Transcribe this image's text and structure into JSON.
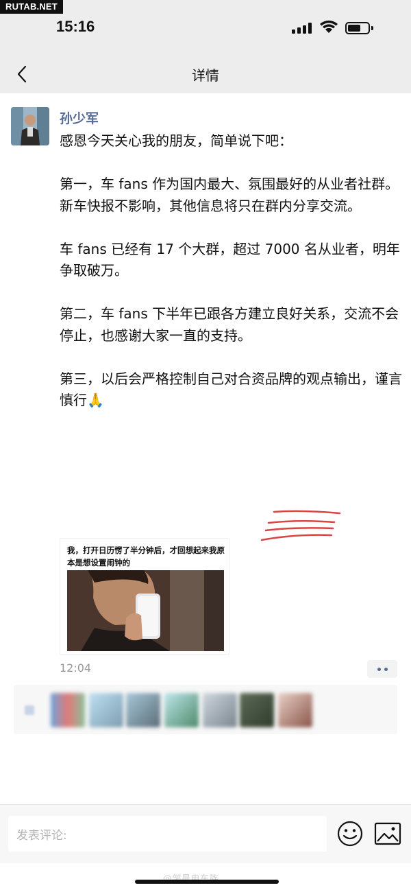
{
  "watermark_top": "RUTAB.NET",
  "status_bar": {
    "time": "15:16"
  },
  "nav": {
    "title": "详情",
    "back_icon": "chevron-left-icon"
  },
  "post": {
    "author": "孙少军",
    "paragraphs": [
      "感恩今天关心我的朋友，简单说下吧：",
      "第一，车 fans 作为国内最大、氛围最好的从业者社群。新车快报不影响，其他信息将只在群内分享交流。",
      "车 fans 已经有 17 个大群，超过 7000 名从业者，明年争取破万。",
      "第二，车 fans 下半年已跟各方建立良好关系，交流不会停止，也感谢大家一直的支持。",
      "第三，以后会严格控制自己对合资品牌的观点输出，谨言慎行🙏"
    ],
    "meme_caption": "我，打开日历愣了半分钟后，才回想起来我原本是想设置闹钟的",
    "time": "12:04"
  },
  "comment": {
    "placeholder": "发表评论:"
  },
  "watermark_bottom": "@邹晨电车族",
  "colors": {
    "author": "#576b95",
    "header_bg": "#ededed",
    "annotation": "#d94444"
  }
}
